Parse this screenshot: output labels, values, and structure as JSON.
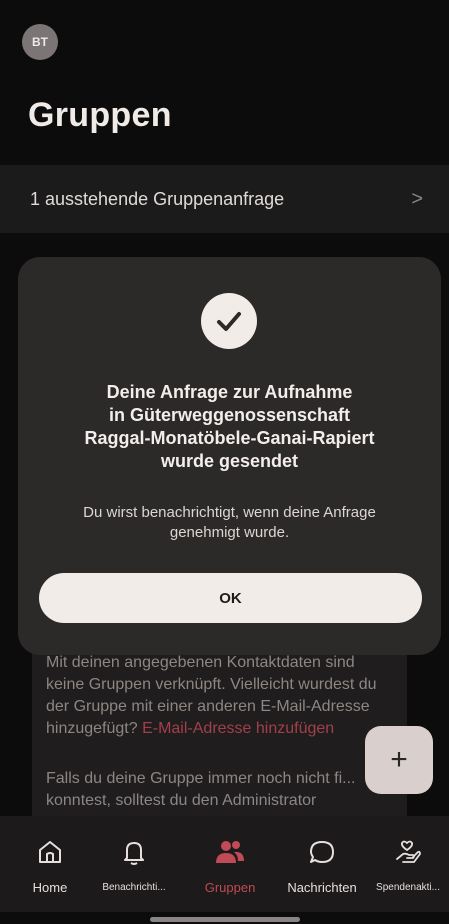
{
  "header": {
    "avatar_initials": "BT",
    "title": "Gruppen"
  },
  "pending": {
    "label": "1 ausstehende Gruppenanfrage",
    "chevron": ">"
  },
  "info": {
    "text_before_link": "Mit deinen angegebenen Kontaktdaten sind keine Gruppen verknüpft. Vielleicht wurdest du der Gruppe mit einer anderen E-Mail-Adresse hinzugefügt? ",
    "link": "E-Mail-Adresse hinzufügen",
    "text2": "Falls du deine Gruppe immer noch nicht fi... konntest, solltest du den Administrator"
  },
  "fab": {
    "label": "+"
  },
  "dialog": {
    "icon": "check-icon",
    "title": "Deine Anfrage zur Aufnahme\nin Güterweggenossenschaft\nRaggal-Monatöbele-Ganai-Rapiert\nwurde gesendet",
    "message": "Du wirst benachrichtigt, wenn deine Anfrage\ngenehmigt wurde.",
    "ok_label": "OK"
  },
  "nav": {
    "items": [
      {
        "label": "Home",
        "icon": "home-icon"
      },
      {
        "label": "Benachrichti...",
        "icon": "bell-icon"
      },
      {
        "label": "Gruppen",
        "icon": "group-icon",
        "active": true
      },
      {
        "label": "Nachrichten",
        "icon": "chat-icon"
      },
      {
        "label": "Spendenakti...",
        "icon": "donation-icon"
      }
    ]
  },
  "colors": {
    "background": "#0d0c0c",
    "accent": "#c04a55",
    "dialog": "#2c2929"
  }
}
